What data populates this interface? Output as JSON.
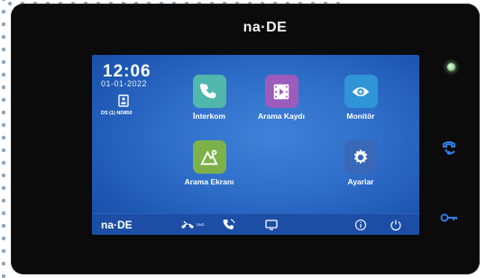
{
  "device": {
    "brand": "na·DE",
    "screen": {
      "clock": "12:06",
      "date": "01-01-2022",
      "device_label": "DS (1) ND850",
      "apps": [
        {
          "id": "intercom",
          "label": "İnterkom",
          "icon": "phone-icon",
          "color": "#4fb7ab"
        },
        {
          "id": "call-log",
          "label": "Arama Kaydı",
          "icon": "film-icon",
          "color": "#9b5cbc"
        },
        {
          "id": "monitor",
          "label": "Monitör",
          "icon": "eye-icon",
          "color": "#2f95d6"
        },
        {
          "id": "call-screen",
          "label": "Arama Ekranı",
          "icon": "picture-icon",
          "color": "#7cb249"
        },
        {
          "id": "settings",
          "label": "Ayarlar",
          "icon": "gear-icon",
          "color": "#3a68b8"
        }
      ],
      "taskbar": {
        "brand": "na·DE",
        "tiny": "DND",
        "icons": [
          "dnd-phone-icon",
          "call-icon",
          "monitor-small-icon",
          "info-icon",
          "power-icon"
        ]
      }
    },
    "side_icons": [
      "indicator-led",
      "unlock-handset-icon",
      "key-icon"
    ]
  }
}
